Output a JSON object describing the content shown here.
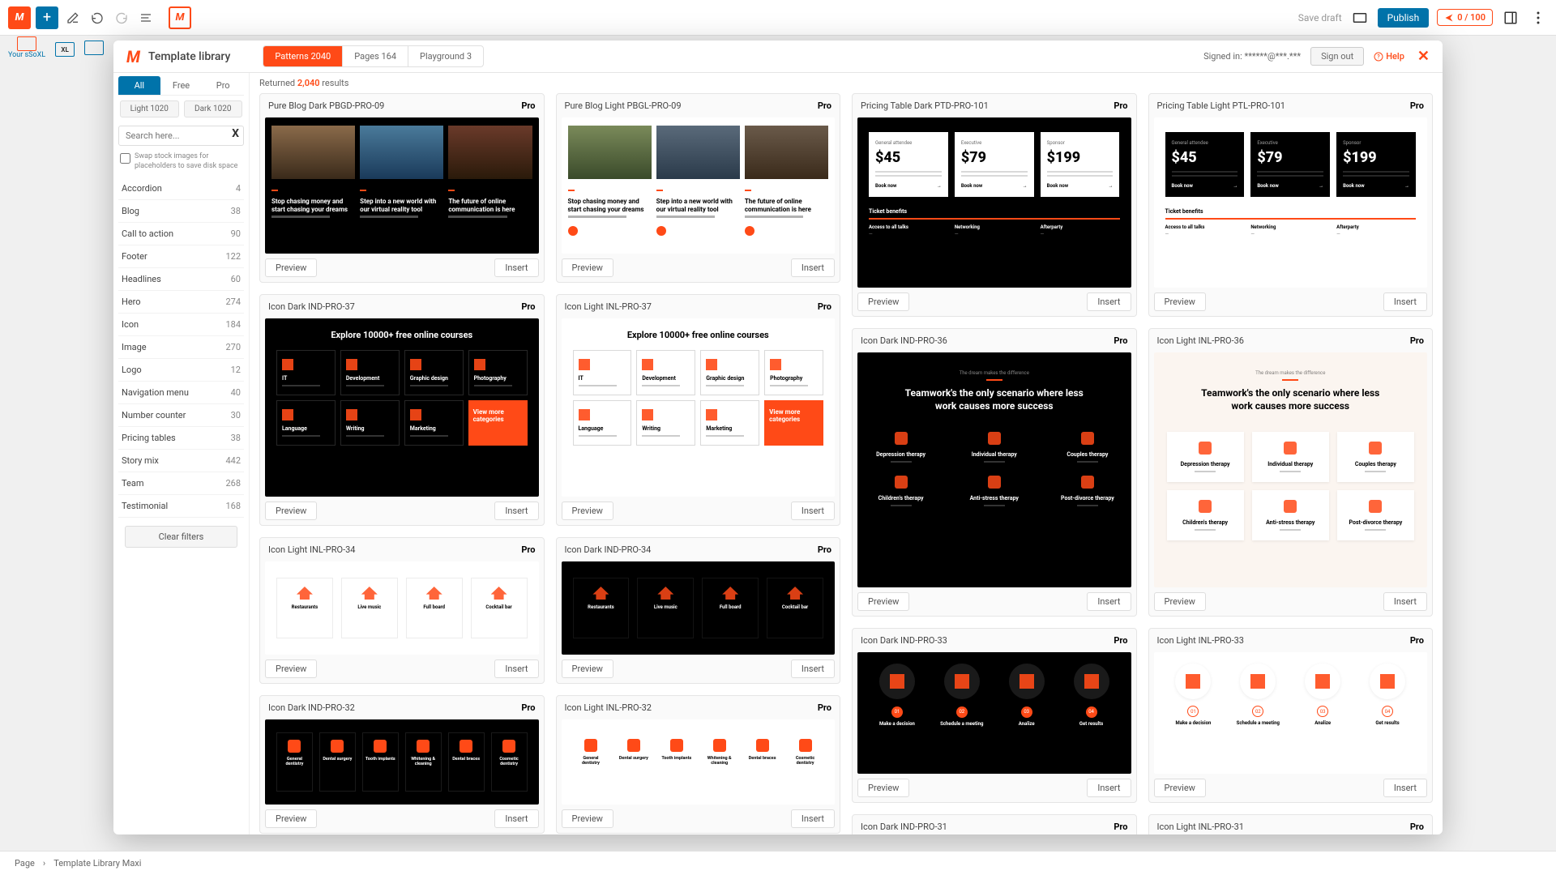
{
  "toolbar": {
    "save_draft": "Save draft",
    "publish": "Publish",
    "credits": "0 / 100"
  },
  "second_toolbar": {
    "label": "Your sSoXL"
  },
  "modal": {
    "title": "Template library",
    "tabs": [
      {
        "label": "Patterns 2040",
        "active": true
      },
      {
        "label": "Pages 164",
        "active": false
      },
      {
        "label": "Playground 3",
        "active": false
      }
    ],
    "signed_in": "Signed in: ******@***.***",
    "sign_out": "Sign out",
    "help": "Help"
  },
  "sidebar": {
    "cost_tabs": [
      "All",
      "Free",
      "Pro"
    ],
    "active_cost": 0,
    "theme_tabs": [
      "Light 1020",
      "Dark 1020"
    ],
    "search_placeholder": "Search here...",
    "swap_label": "Swap stock images for placeholders to save disk space",
    "categories": [
      {
        "name": "Accordion",
        "count": 4
      },
      {
        "name": "Blog",
        "count": 38
      },
      {
        "name": "Call to action",
        "count": 90
      },
      {
        "name": "Footer",
        "count": 122
      },
      {
        "name": "Headlines",
        "count": 60
      },
      {
        "name": "Hero",
        "count": 274
      },
      {
        "name": "Icon",
        "count": 184
      },
      {
        "name": "Image",
        "count": 270
      },
      {
        "name": "Logo",
        "count": 12
      },
      {
        "name": "Navigation menu",
        "count": 40
      },
      {
        "name": "Number counter",
        "count": 30
      },
      {
        "name": "Pricing tables",
        "count": 38
      },
      {
        "name": "Story mix",
        "count": 442
      },
      {
        "name": "Team",
        "count": 268
      },
      {
        "name": "Testimonial",
        "count": 168
      }
    ],
    "clear_filters": "Clear filters"
  },
  "results": {
    "returned_pre": "Returned ",
    "returned_count": "2,040",
    "returned_post": " results",
    "preview": "Preview",
    "insert": "Insert",
    "pro": "Pro",
    "cards": {
      "c1": "Pure Blog Dark PBGD-PRO-09",
      "c2": "Pure Blog Light PBGL-PRO-09",
      "c3": "Pricing Table Dark PTD-PRO-101",
      "c4": "Pricing Table Light PTL-PRO-101",
      "c5": "Icon Dark IND-PRO-37",
      "c6": "Icon Light INL-PRO-37",
      "c7": "Icon Dark IND-PRO-36",
      "c8": "Icon Light INL-PRO-36",
      "c9": "Icon Light INL-PRO-34",
      "c10": "Icon Dark IND-PRO-34",
      "c11": "Icon Dark IND-PRO-33",
      "c12": "Icon Light INL-PRO-33",
      "c13": "Icon Dark IND-PRO-32",
      "c14": "Icon Light INL-PRO-32",
      "c15": "Icon Dark IND-PRO-31",
      "c16": "Icon Light INL-PRO-31"
    }
  },
  "thumbs": {
    "blog_h1": "Stop chasing money and start chasing your dreams",
    "blog_h2": "Step into a new world with our virtual reality tool",
    "blog_h3": "The future of online communication is here",
    "blog_h3b": "The future of online communication is here",
    "pricing": {
      "p1_l": "General attendee",
      "p1_v": "$45",
      "p2_l": "Executive",
      "p2_v": "$79",
      "p3_l": "Sponsor",
      "p3_v": "$199",
      "book": "Book now",
      "tb": "Ticket benefits",
      "r1a": "Access to all talks",
      "r1b": "Networking",
      "r1c": "Afterparty"
    },
    "courses_h": "Explore 10000+ free online courses",
    "courses": [
      "IT",
      "Development",
      "Graphic design",
      "Photography",
      "Language",
      "Writing",
      "Marketing",
      "View more categories"
    ],
    "team_sub": "The dream makes the difference",
    "team_h1": "Teamwork's the only scenario where less",
    "team_h2": "work causes more success",
    "team_items": [
      "Depression therapy",
      "Individual therapy",
      "Couples therapy",
      "Children's therapy",
      "Anti-stress therapy",
      "Post-divorce therapy"
    ],
    "rest": [
      "Restaurants",
      "Live music",
      "Full board",
      "Cocktail bar"
    ],
    "dent": [
      "General dentistry",
      "Dental surgery",
      "Tooth implants",
      "Whitening & cleaning",
      "Dental braces",
      "Cosmetic dentistry"
    ],
    "bubbles": [
      "Make a decision",
      "Schedule a meeting",
      "Analize",
      "Get results"
    ]
  },
  "breadcrumb": {
    "a": "Page",
    "b": "Template Library Maxi"
  }
}
